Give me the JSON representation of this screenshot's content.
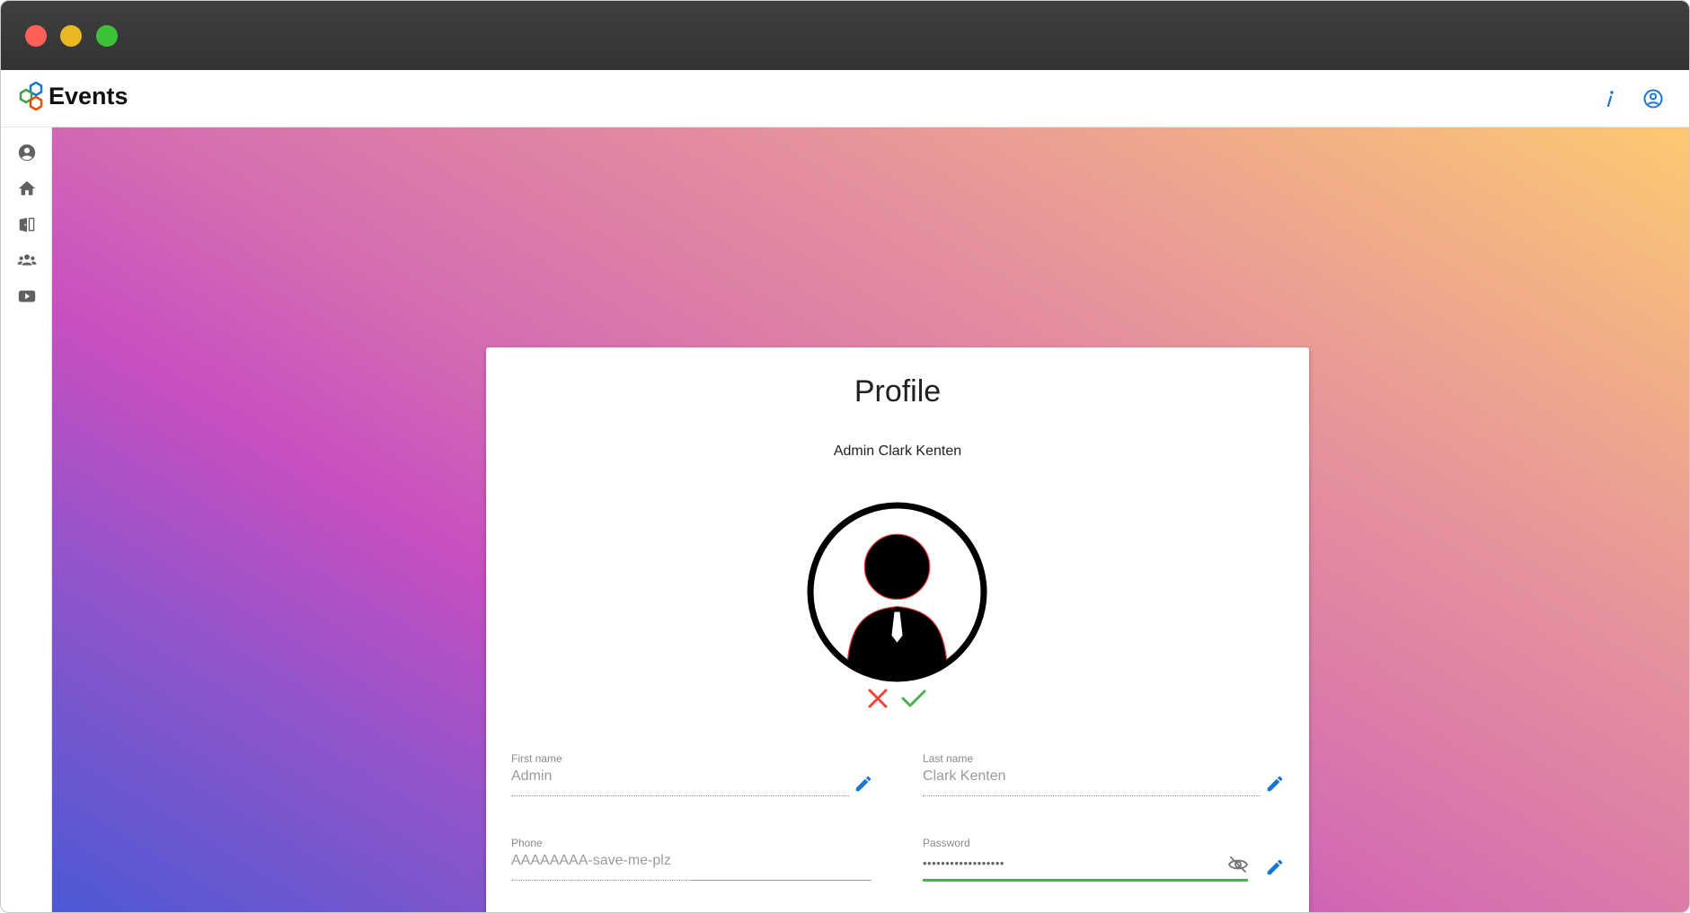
{
  "app": {
    "brand": "Events",
    "colors": {
      "accent_blue": "#1976d2",
      "success_green": "#4caf50",
      "cancel_red": "#f44336"
    }
  },
  "appbar": {
    "info_icon": "info-icon",
    "account_icon": "account-circle-icon"
  },
  "sidebar": {
    "items": [
      {
        "icon": "account-circle-icon"
      },
      {
        "icon": "home-icon"
      },
      {
        "icon": "door-icon"
      },
      {
        "icon": "group-icon"
      },
      {
        "icon": "video-icon"
      }
    ]
  },
  "profile": {
    "title": "Profile",
    "subtitle": "Admin Clark Kenten",
    "avatar_icon": "person-avatar-icon",
    "fields": {
      "first_name": {
        "label": "First name",
        "value": "Admin"
      },
      "last_name": {
        "label": "Last name",
        "value": "Clark Kenten"
      },
      "phone": {
        "label": "Phone",
        "value": "AAAAAAAA-save-me-plz"
      },
      "password": {
        "label": "Password",
        "value": "••••••••••••••••••"
      }
    }
  }
}
